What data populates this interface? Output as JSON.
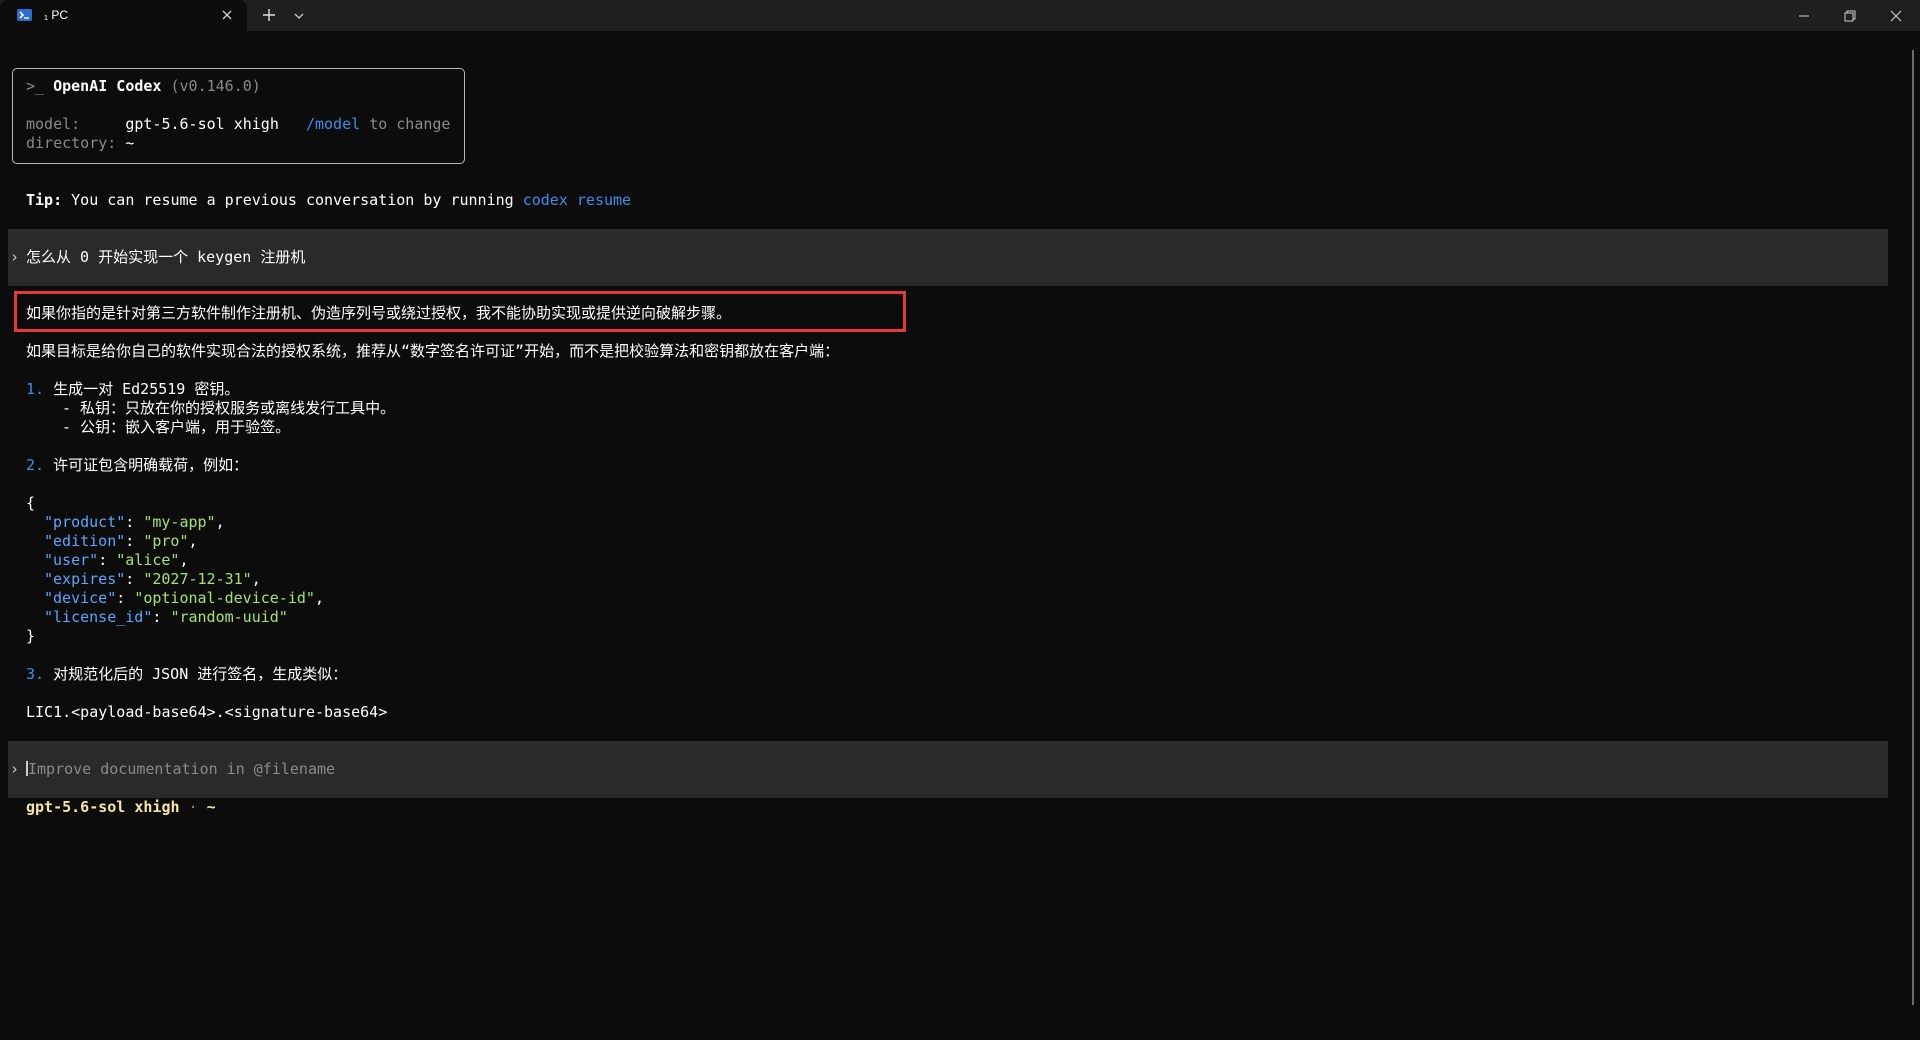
{
  "window": {
    "tab_title": "₁ PC",
    "tab_title_text": "PC",
    "icons": [
      "terminal-icon",
      "close-icon",
      "plus-icon",
      "chevron-down-icon",
      "minimize-icon",
      "restore-icon",
      "window-close-icon"
    ]
  },
  "header": {
    "prompt": ">_",
    "app_name": "OpenAI Codex",
    "version": "(v0.146.0)",
    "model_label": "model:",
    "model_value": "gpt-5.6-sol xhigh",
    "model_cmd": "/model",
    "model_hint": "to change",
    "dir_label": "directory:",
    "dir_value": "~"
  },
  "tip": {
    "label": "Tip:",
    "text": "You can resume a previous conversation by running",
    "command": "codex resume"
  },
  "user_message": "怎么从 0 开始实现一个 keygen 注册机",
  "response": {
    "refusal": "如果你指的是针对第三方软件制作注册机、伪造序列号或绕过授权，我不能协助实现或提供逆向破解步骤。",
    "intro": "如果目标是给你自己的软件实现合法的授权系统，推荐从“数字签名许可证”开始，而不是把校验算法和密钥都放在客户端：",
    "step1_num": "1.",
    "step1": "生成一对 Ed25519 密钥。",
    "step1_a": "- 私钥：只放在你的授权服务或离线发行工具中。",
    "step1_b": "- 公钥：嵌入客户端，用于验签。",
    "step2_num": "2.",
    "step2": "许可证包含明确载荷，例如：",
    "json_open": "{",
    "json_close": "}",
    "json_fields": [
      {
        "key": "\"product\"",
        "value": "\"my-app\"",
        "sep": ","
      },
      {
        "key": "\"edition\"",
        "value": "\"pro\"",
        "sep": ","
      },
      {
        "key": "\"user\"",
        "value": "\"alice\"",
        "sep": ","
      },
      {
        "key": "\"expires\"",
        "value": "\"2027-12-31\"",
        "sep": ","
      },
      {
        "key": "\"device\"",
        "value": "\"optional-device-id\"",
        "sep": ","
      },
      {
        "key": "\"license_id\"",
        "value": "\"random-uuid\"",
        "sep": ""
      }
    ],
    "step3_num": "3.",
    "step3": "对规范化后的 JSON 进行签名，生成类似：",
    "license_format": "LIC1.<payload-base64>.<signature-base64>"
  },
  "input": {
    "chevron": "›",
    "placeholder": "Improve documentation in @filename"
  },
  "status": {
    "model": "gpt-5.6-sol xhigh",
    "separator": "·",
    "dir": "~"
  },
  "colors": {
    "background": "#0c0c0c",
    "titlebar": "#1f1f1f",
    "prompt_block": "#2a2a2a",
    "accent_blue": "#3b8eea",
    "string_green": "#a7e26a",
    "highlight_red": "#e53935"
  }
}
